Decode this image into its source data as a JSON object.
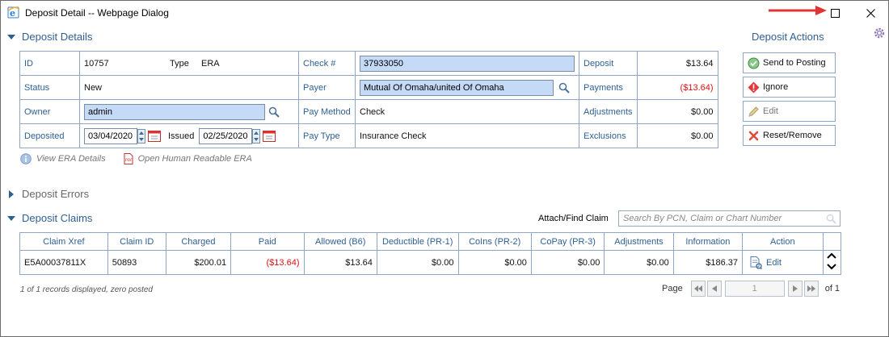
{
  "window": {
    "title": "Deposit Detail -- Webpage Dialog"
  },
  "sections": {
    "deposit_details": "Deposit Details",
    "deposit_actions": "Deposit Actions",
    "deposit_errors": "Deposit Errors",
    "deposit_claims": "Deposit Claims"
  },
  "details": {
    "id_label": "ID",
    "id_value": "10757",
    "type_label": "Type",
    "type_value": "ERA",
    "status_label": "Status",
    "status_value": "New",
    "owner_label": "Owner",
    "owner_value": "admin",
    "deposited_label": "Deposited",
    "deposited_value": "03/04/2020",
    "issued_label": "Issued",
    "issued_value": "02/25/2020",
    "check_label": "Check #",
    "check_value": "37933050",
    "payer_label": "Payer",
    "payer_value": "Mutual Of Omaha/united Of Omaha",
    "pay_method_label": "Pay Method",
    "pay_method_value": "Check",
    "pay_type_label": "Pay Type",
    "pay_type_value": "Insurance Check",
    "deposit_label": "Deposit",
    "deposit_value": "$13.64",
    "payments_label": "Payments",
    "payments_value": "($13.64)",
    "adjustments_label": "Adjustments",
    "adjustments_value": "$0.00",
    "exclusions_label": "Exclusions",
    "exclusions_value": "$0.00"
  },
  "actions": {
    "send_to_posting": "Send to Posting",
    "ignore": "Ignore",
    "edit": "Edit",
    "reset_remove": "Reset/Remove"
  },
  "era_links": {
    "view_era": "View ERA Details",
    "open_readable": "Open Human Readable ERA"
  },
  "claims": {
    "attach_label": "Attach/Find Claim",
    "search_placeholder": "Search By PCN, Claim or Chart Number",
    "columns": [
      "Claim Xref",
      "Claim ID",
      "Charged",
      "Paid",
      "Allowed (B6)",
      "Deductible (PR-1)",
      "CoIns (PR-2)",
      "CoPay (PR-3)",
      "Adjustments",
      "Information",
      "Action"
    ],
    "rows": [
      {
        "claim_xref": "E5A00037811X",
        "claim_id": "50893",
        "charged": "$200.01",
        "paid": "($13.64)",
        "allowed": "$13.64",
        "deductible": "$0.00",
        "coins": "$0.00",
        "copay": "$0.00",
        "adjustments": "$0.00",
        "information": "$186.37",
        "action": "Edit"
      }
    ]
  },
  "footer": {
    "records_note": "1 of 1 records displayed, zero posted",
    "page_label": "Page",
    "page_value": "1",
    "of_label": "of 1"
  },
  "colors": {
    "accent": "#2e5f93",
    "negative": "#dd1111",
    "input_bg": "#c5daf6"
  }
}
